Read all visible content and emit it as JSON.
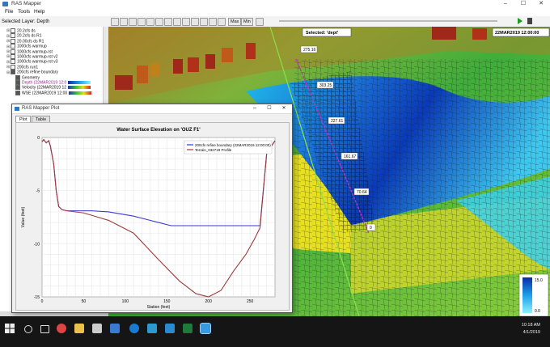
{
  "app": {
    "title": "RAS Mapper"
  },
  "menu": [
    "File",
    "Tools",
    "Help"
  ],
  "toolbar": {
    "max_label": "Max",
    "min_label": "Min"
  },
  "layer_panel": {
    "header": "Selected Layer: Depth",
    "items": [
      {
        "label": "20.2cfs ds",
        "indent": 1
      },
      {
        "label": "20.2cfs ds R1",
        "indent": 1
      },
      {
        "label": "20.00cfs ds R1",
        "indent": 1
      },
      {
        "label": "1000cfs warmup",
        "indent": 1
      },
      {
        "label": "1000cfs warmup-rst",
        "indent": 1
      },
      {
        "label": "1000cfs warmup-rst v2",
        "indent": 1
      },
      {
        "label": "1000cfs warmup-rst v3",
        "indent": 1
      },
      {
        "label": "200cfs run1",
        "indent": 1
      },
      {
        "label": "200cfs refine boundary",
        "indent": 1
      },
      {
        "label": "Geometry",
        "indent": 2
      },
      {
        "label": "Depth (22MAR2019 12:0",
        "indent": 2,
        "highlight": true
      },
      {
        "label": "Velocity (22MAR2019 12",
        "indent": 2
      },
      {
        "label": "WSE (22MAR2019 12:00",
        "indent": 2
      }
    ]
  },
  "map": {
    "selected_label": "Selected: 'dept'",
    "timestamp": "22MAR2019 12:00:00",
    "profile_labels": [
      "275.16",
      "303.25",
      "227.61",
      "161.67",
      "70.64",
      "0"
    ],
    "legend_max": "15.0",
    "legend_min": "0.0"
  },
  "plot_window": {
    "title": "RAS Mapper Plot",
    "tabs": [
      "Plot",
      "Table"
    ]
  },
  "chart_data": {
    "type": "line",
    "title": "Water Surface Elevation on 'OUZ F1'",
    "xlabel": "Station (feet)",
    "ylabel": "Value (feet)",
    "xlim": [
      0,
      280
    ],
    "ylim": [
      -15,
      0
    ],
    "xticks": [
      0,
      50,
      100,
      150,
      200,
      250
    ],
    "yticks": [
      0,
      -5,
      -10,
      -15
    ],
    "grid": true,
    "legend_position": "top-right",
    "series": [
      {
        "name": "200cfs refine boundary (22MAR2019 12:00:00)",
        "color": "#3a3ad0",
        "x": [
          0,
          2,
          5,
          8,
          10,
          14,
          17,
          20,
          24,
          30,
          40,
          60,
          80,
          95,
          110,
          125,
          140,
          155,
          165,
          200,
          240,
          262,
          270,
          280
        ],
        "y": [
          -0.4,
          -0.2,
          -0.5,
          -0.3,
          -0.8,
          -2.5,
          -5,
          -6.5,
          -6.8,
          -6.9,
          -6.9,
          -6.9,
          -7.0,
          -7.2,
          -7.4,
          -7.7,
          -8.0,
          -8.3,
          -8.3,
          -8.3,
          -8.3,
          -8.3,
          -1.5,
          -0.3
        ]
      },
      {
        "name": "Terrain_032719 Profile",
        "color": "#a03a3a",
        "x": [
          0,
          2,
          5,
          8,
          10,
          14,
          17,
          20,
          24,
          30,
          50,
          80,
          110,
          140,
          165,
          185,
          200,
          215,
          230,
          245,
          255,
          262,
          270,
          280
        ],
        "y": [
          -0.4,
          -0.2,
          -0.5,
          -0.3,
          -0.8,
          -2.5,
          -5,
          -6.5,
          -6.8,
          -6.9,
          -7.1,
          -7.8,
          -9.0,
          -11.5,
          -13.5,
          -14.7,
          -15.0,
          -14.4,
          -12.6,
          -11.0,
          -9.6,
          -8.5,
          -1.5,
          -0.3
        ]
      }
    ]
  },
  "taskbar": {
    "time": "10:18 AM",
    "date": "4/1/2019"
  },
  "colors": {
    "accent": "#2a7ac9",
    "selection": "#3399ff"
  }
}
